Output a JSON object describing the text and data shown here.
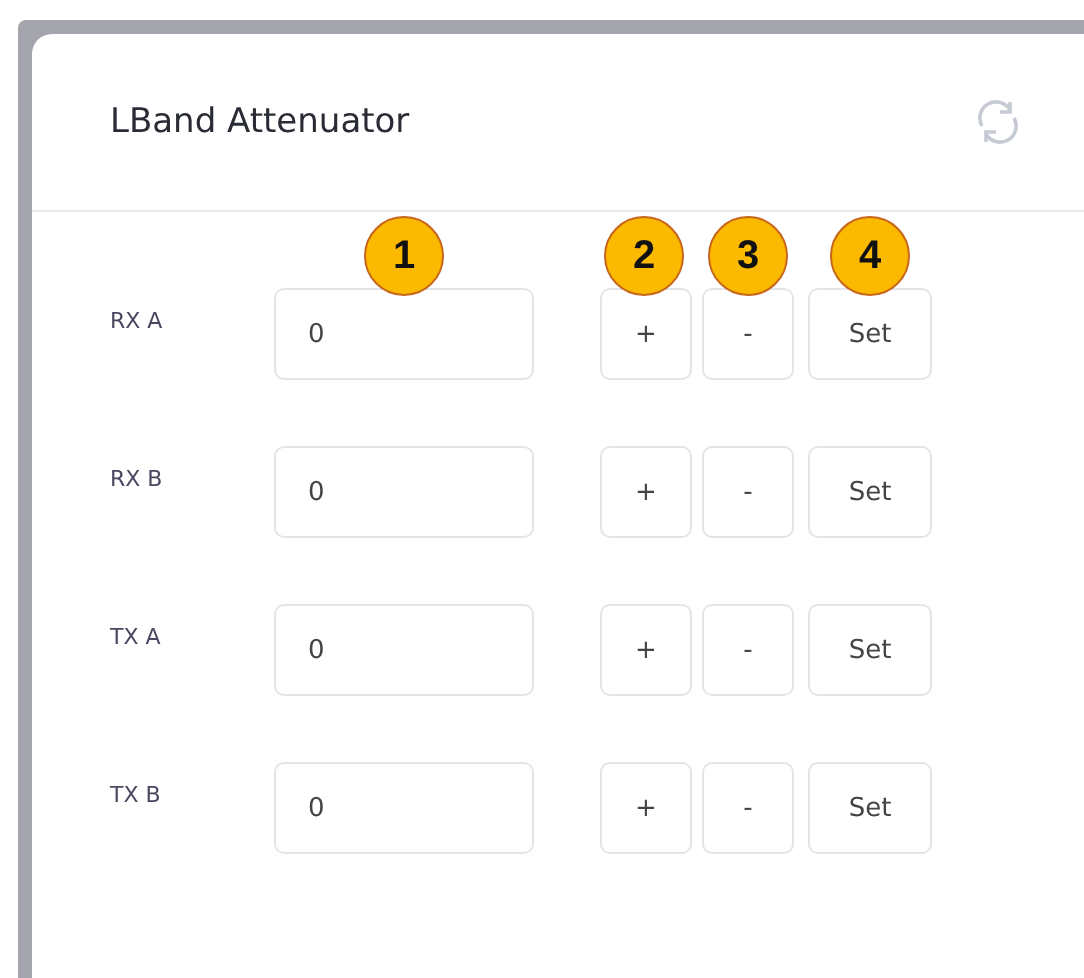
{
  "card": {
    "title": "LBand Attenuator"
  },
  "rows": [
    {
      "label": "RX A",
      "value": "0",
      "buttons": [
        "+",
        "-",
        "Set"
      ]
    },
    {
      "label": "RX B",
      "value": "0",
      "buttons": [
        "+",
        "-",
        "Set"
      ]
    },
    {
      "label": "TX A",
      "value": "0",
      "buttons": [
        "+",
        "-",
        "Set"
      ]
    },
    {
      "label": "TX B",
      "value": "0",
      "buttons": [
        "+",
        "-",
        "Set"
      ]
    }
  ],
  "callouts": [
    "1",
    "2",
    "3",
    "4"
  ]
}
